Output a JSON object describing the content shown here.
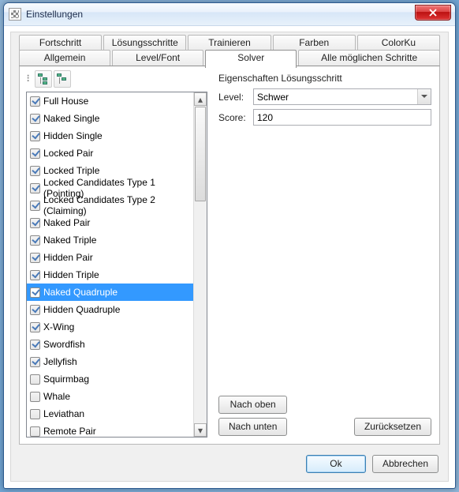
{
  "window": {
    "title": "Einstellungen"
  },
  "tabs_row1": [
    {
      "label": "Fortschritt"
    },
    {
      "label": "Lösungsschritte"
    },
    {
      "label": "Trainieren"
    },
    {
      "label": "Farben"
    },
    {
      "label": "ColorKu"
    }
  ],
  "tabs_row2": [
    {
      "label": "Allgemein"
    },
    {
      "label": "Level/Font"
    },
    {
      "label": "Solver",
      "active": true
    },
    {
      "label": "Alle möglichen Schritte"
    }
  ],
  "techniques": [
    {
      "label": "Full House",
      "checked": true
    },
    {
      "label": "Naked Single",
      "checked": true
    },
    {
      "label": "Hidden Single",
      "checked": true
    },
    {
      "label": "Locked Pair",
      "checked": true
    },
    {
      "label": "Locked Triple",
      "checked": true
    },
    {
      "label": "Locked Candidates Type 1 (Pointing)",
      "checked": true
    },
    {
      "label": "Locked Candidates Type 2 (Claiming)",
      "checked": true
    },
    {
      "label": "Naked Pair",
      "checked": true
    },
    {
      "label": "Naked Triple",
      "checked": true
    },
    {
      "label": "Hidden Pair",
      "checked": true
    },
    {
      "label": "Hidden Triple",
      "checked": true
    },
    {
      "label": "Naked Quadruple",
      "checked": true,
      "selected": true
    },
    {
      "label": "Hidden Quadruple",
      "checked": true
    },
    {
      "label": "X-Wing",
      "checked": true
    },
    {
      "label": "Swordfish",
      "checked": true
    },
    {
      "label": "Jellyfish",
      "checked": true
    },
    {
      "label": "Squirmbag",
      "checked": false
    },
    {
      "label": "Whale",
      "checked": false
    },
    {
      "label": "Leviathan",
      "checked": false
    },
    {
      "label": "Remote Pair",
      "checked": false
    }
  ],
  "properties": {
    "heading": "Eigenschaften Lösungsschritt",
    "level_label": "Level:",
    "level_value": "Schwer",
    "score_label": "Score:",
    "score_value": "120"
  },
  "buttons": {
    "up": "Nach oben",
    "down": "Nach unten",
    "reset": "Zurücksetzen",
    "ok": "Ok",
    "cancel": "Abbrechen"
  }
}
